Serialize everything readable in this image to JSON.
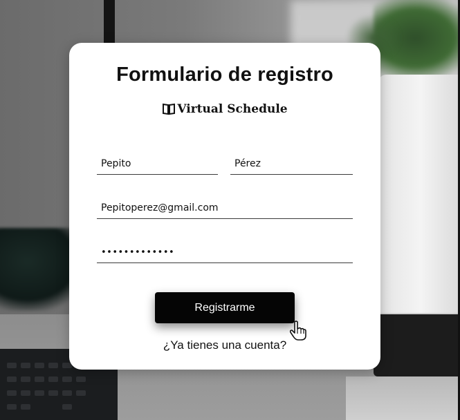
{
  "form": {
    "title": "Formulario de registro",
    "brand": {
      "icon": "open-book-icon",
      "name": "Virtual Schedule"
    },
    "fields": {
      "first_name": {
        "value": "Pepito"
      },
      "last_name": {
        "value": "Pérez"
      },
      "email": {
        "value": "Pepitoperez@gmail.com"
      },
      "password": {
        "value": "•••••••••••••"
      }
    },
    "submit_label": "Registrarme",
    "login_link": "¿Ya tienes una cuenta?",
    "colors": {
      "card": "#ffffff",
      "button": "#050505",
      "button_text": "#ffffff"
    }
  }
}
